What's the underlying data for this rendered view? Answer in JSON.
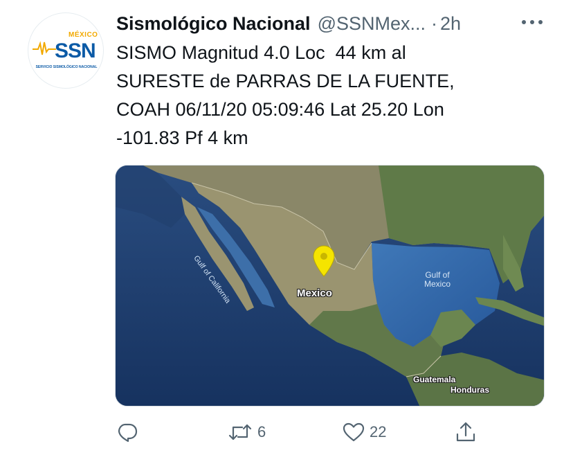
{
  "author": {
    "display_name": "Sismológico Nacional",
    "handle": "@SSNMex...",
    "separator": "·",
    "time_ago": "2h",
    "avatar": {
      "country": "MÉXICO",
      "acronym": "SSN",
      "full_name": "SERVICIO SISMOLÓGICO NACIONAL"
    }
  },
  "tweet": {
    "text": "SISMO Magnitud 4.0 Loc  44 km al\nSURESTE de PARRAS DE LA FUENTE,\nCOAH 06/11/20 05:09:46 Lat 25.20 Lon\n-101.83 Pf 4 km"
  },
  "map": {
    "labels": {
      "country": "Mexico",
      "gulf_mexico_line1": "Gulf of",
      "gulf_mexico_line2": "Mexico",
      "gulf_california": "Gulf of California",
      "guatemala": "Guatemala",
      "honduras": "Honduras"
    },
    "pin_color": "#f5e400"
  },
  "actions": {
    "reply_icon": "reply-icon",
    "retweet_icon": "retweet-icon",
    "retweet_count": "6",
    "like_icon": "heart-icon",
    "like_count": "22",
    "share_icon": "share-icon"
  },
  "colors": {
    "text_primary": "#0f1419",
    "text_secondary": "#536471",
    "ssn_blue": "#0b5aa6",
    "ssn_gold": "#f2a900"
  }
}
